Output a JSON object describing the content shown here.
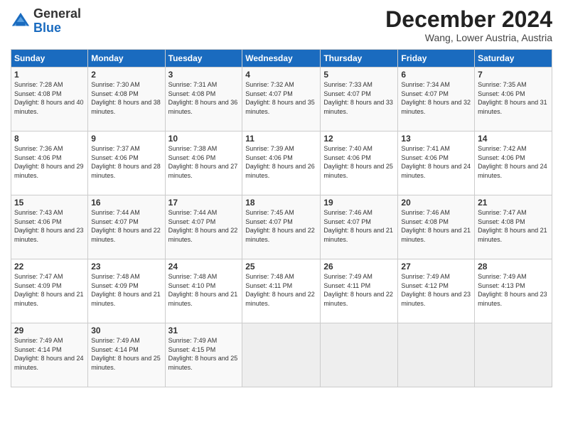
{
  "logo": {
    "line1": "General",
    "line2": "Blue"
  },
  "title": "December 2024",
  "location": "Wang, Lower Austria, Austria",
  "days_header": [
    "Sunday",
    "Monday",
    "Tuesday",
    "Wednesday",
    "Thursday",
    "Friday",
    "Saturday"
  ],
  "weeks": [
    [
      {
        "num": "1",
        "sunrise": "7:28 AM",
        "sunset": "4:08 PM",
        "daylight": "8 hours and 40 minutes."
      },
      {
        "num": "2",
        "sunrise": "7:30 AM",
        "sunset": "4:08 PM",
        "daylight": "8 hours and 38 minutes."
      },
      {
        "num": "3",
        "sunrise": "7:31 AM",
        "sunset": "4:08 PM",
        "daylight": "8 hours and 36 minutes."
      },
      {
        "num": "4",
        "sunrise": "7:32 AM",
        "sunset": "4:07 PM",
        "daylight": "8 hours and 35 minutes."
      },
      {
        "num": "5",
        "sunrise": "7:33 AM",
        "sunset": "4:07 PM",
        "daylight": "8 hours and 33 minutes."
      },
      {
        "num": "6",
        "sunrise": "7:34 AM",
        "sunset": "4:07 PM",
        "daylight": "8 hours and 32 minutes."
      },
      {
        "num": "7",
        "sunrise": "7:35 AM",
        "sunset": "4:06 PM",
        "daylight": "8 hours and 31 minutes."
      }
    ],
    [
      {
        "num": "8",
        "sunrise": "7:36 AM",
        "sunset": "4:06 PM",
        "daylight": "8 hours and 29 minutes."
      },
      {
        "num": "9",
        "sunrise": "7:37 AM",
        "sunset": "4:06 PM",
        "daylight": "8 hours and 28 minutes."
      },
      {
        "num": "10",
        "sunrise": "7:38 AM",
        "sunset": "4:06 PM",
        "daylight": "8 hours and 27 minutes."
      },
      {
        "num": "11",
        "sunrise": "7:39 AM",
        "sunset": "4:06 PM",
        "daylight": "8 hours and 26 minutes."
      },
      {
        "num": "12",
        "sunrise": "7:40 AM",
        "sunset": "4:06 PM",
        "daylight": "8 hours and 25 minutes."
      },
      {
        "num": "13",
        "sunrise": "7:41 AM",
        "sunset": "4:06 PM",
        "daylight": "8 hours and 24 minutes."
      },
      {
        "num": "14",
        "sunrise": "7:42 AM",
        "sunset": "4:06 PM",
        "daylight": "8 hours and 24 minutes."
      }
    ],
    [
      {
        "num": "15",
        "sunrise": "7:43 AM",
        "sunset": "4:06 PM",
        "daylight": "8 hours and 23 minutes."
      },
      {
        "num": "16",
        "sunrise": "7:44 AM",
        "sunset": "4:07 PM",
        "daylight": "8 hours and 22 minutes."
      },
      {
        "num": "17",
        "sunrise": "7:44 AM",
        "sunset": "4:07 PM",
        "daylight": "8 hours and 22 minutes."
      },
      {
        "num": "18",
        "sunrise": "7:45 AM",
        "sunset": "4:07 PM",
        "daylight": "8 hours and 22 minutes."
      },
      {
        "num": "19",
        "sunrise": "7:46 AM",
        "sunset": "4:07 PM",
        "daylight": "8 hours and 21 minutes."
      },
      {
        "num": "20",
        "sunrise": "7:46 AM",
        "sunset": "4:08 PM",
        "daylight": "8 hours and 21 minutes."
      },
      {
        "num": "21",
        "sunrise": "7:47 AM",
        "sunset": "4:08 PM",
        "daylight": "8 hours and 21 minutes."
      }
    ],
    [
      {
        "num": "22",
        "sunrise": "7:47 AM",
        "sunset": "4:09 PM",
        "daylight": "8 hours and 21 minutes."
      },
      {
        "num": "23",
        "sunrise": "7:48 AM",
        "sunset": "4:09 PM",
        "daylight": "8 hours and 21 minutes."
      },
      {
        "num": "24",
        "sunrise": "7:48 AM",
        "sunset": "4:10 PM",
        "daylight": "8 hours and 21 minutes."
      },
      {
        "num": "25",
        "sunrise": "7:48 AM",
        "sunset": "4:11 PM",
        "daylight": "8 hours and 22 minutes."
      },
      {
        "num": "26",
        "sunrise": "7:49 AM",
        "sunset": "4:11 PM",
        "daylight": "8 hours and 22 minutes."
      },
      {
        "num": "27",
        "sunrise": "7:49 AM",
        "sunset": "4:12 PM",
        "daylight": "8 hours and 23 minutes."
      },
      {
        "num": "28",
        "sunrise": "7:49 AM",
        "sunset": "4:13 PM",
        "daylight": "8 hours and 23 minutes."
      }
    ],
    [
      {
        "num": "29",
        "sunrise": "7:49 AM",
        "sunset": "4:14 PM",
        "daylight": "8 hours and 24 minutes."
      },
      {
        "num": "30",
        "sunrise": "7:49 AM",
        "sunset": "4:14 PM",
        "daylight": "8 hours and 25 minutes."
      },
      {
        "num": "31",
        "sunrise": "7:49 AM",
        "sunset": "4:15 PM",
        "daylight": "8 hours and 25 minutes."
      },
      null,
      null,
      null,
      null
    ]
  ]
}
